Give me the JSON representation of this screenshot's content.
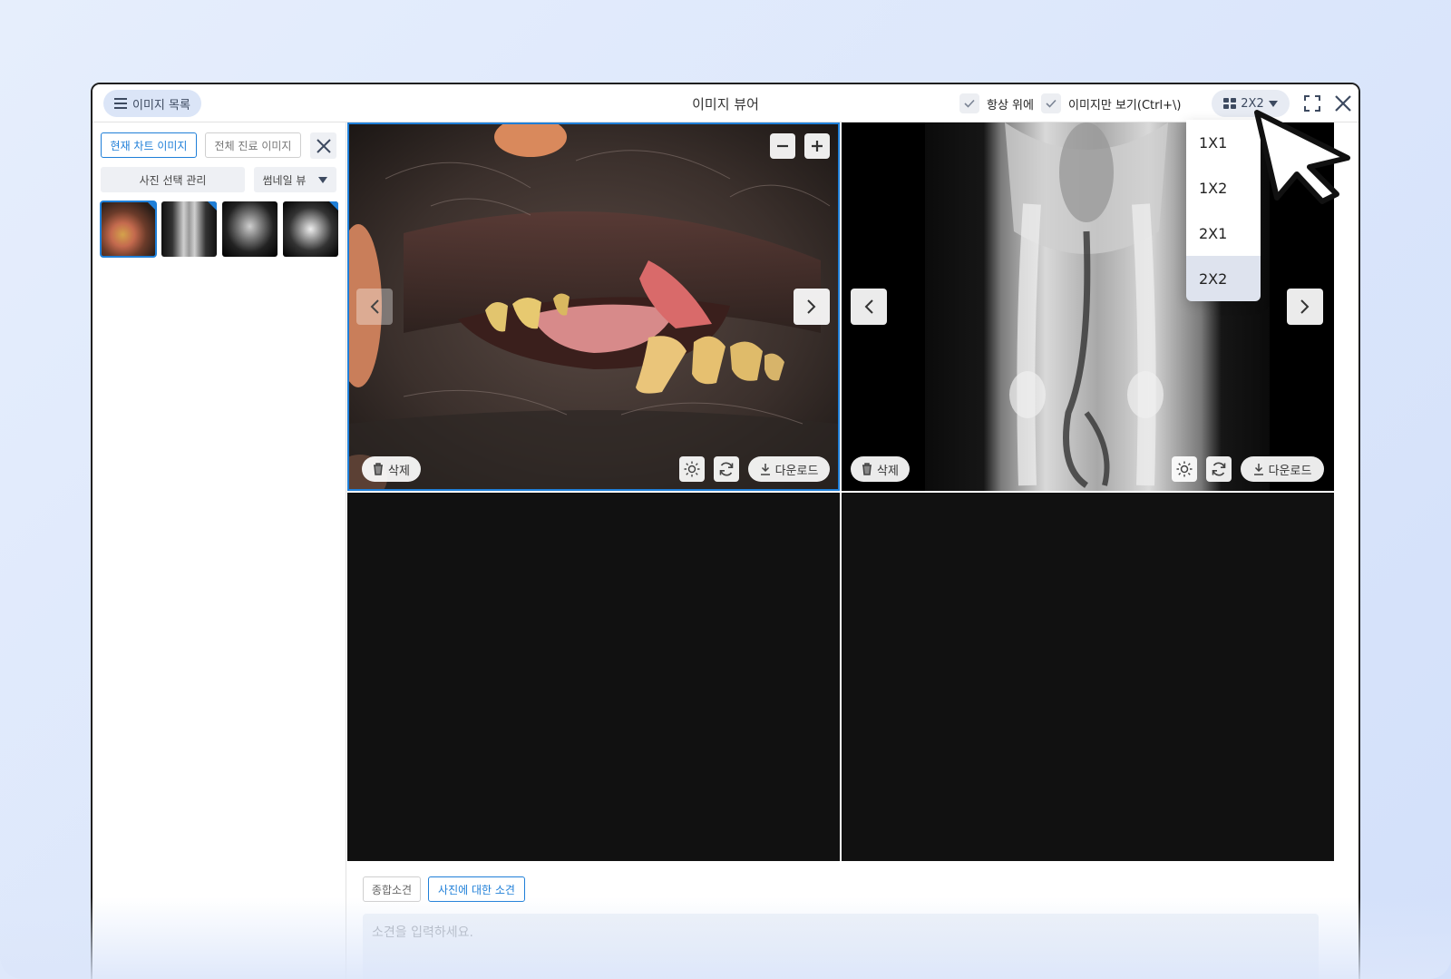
{
  "window": {
    "title": "이미지 뷰어",
    "image_list_label": "이미지 목록",
    "always_on_top_label": "항상 위에",
    "image_only_label": "이미지만 보기(Ctrl+\\)",
    "layout_value": "2X2"
  },
  "sidebar": {
    "tab_current": "현재 차트 이미지",
    "tab_all": "전체 진료 이미지",
    "manage_label": "사진 선택 관리",
    "view_mode_label": "썸네일 뷰"
  },
  "layout_menu": {
    "options": [
      "1X1",
      "1X2",
      "2X1",
      "2X2"
    ],
    "selected": "2X2"
  },
  "cells": {
    "delete_label": "삭제",
    "download_label": "다운로드"
  },
  "bottom": {
    "tab_overall": "종합소견",
    "tab_photo": "사진에 대한 소견",
    "opinion_placeholder": "소견을 입력하세요."
  },
  "colors": {
    "accent": "#1f7fd8",
    "pill_bg": "#dbe5f7",
    "cell_bg": "#111111"
  }
}
